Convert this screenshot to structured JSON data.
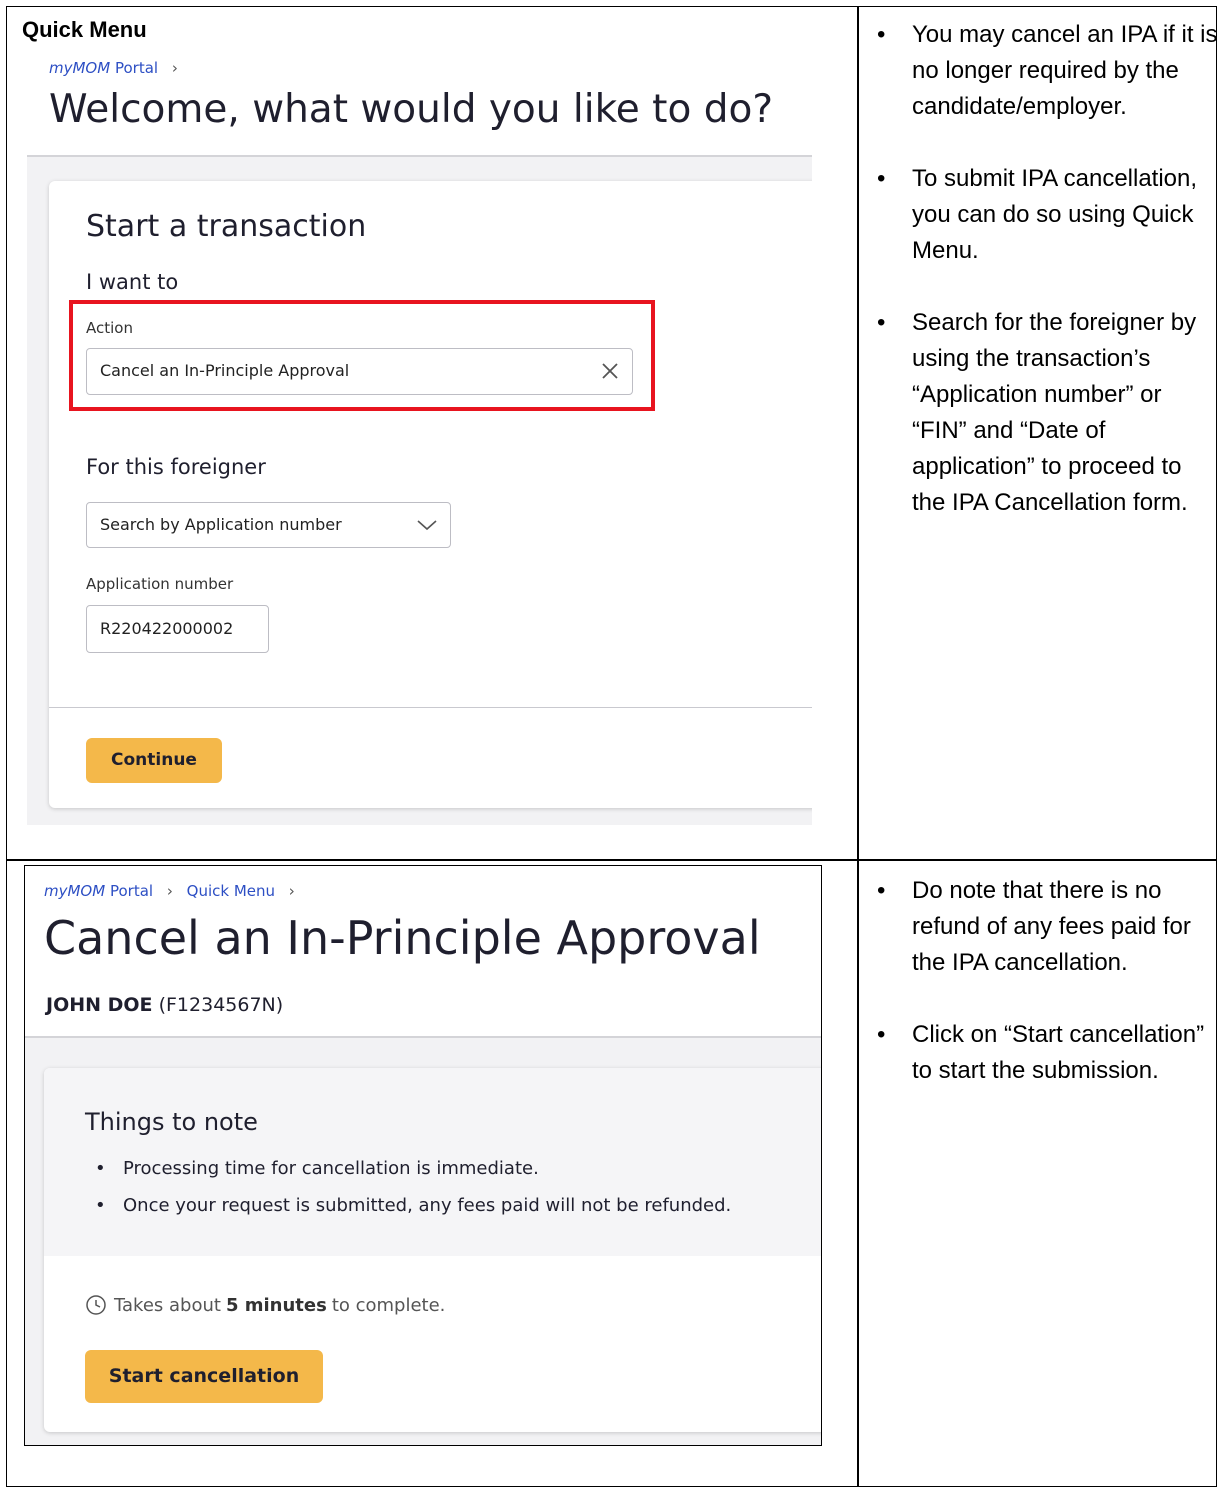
{
  "section": {
    "heading": "Quick Menu"
  },
  "shot1": {
    "breadcrumb": {
      "brand": "myMOM",
      "portal": "Portal"
    },
    "welcome": "Welcome, what would you like to do?",
    "card": {
      "title": "Start a transaction",
      "i_want_to": "I want to",
      "action_label": "Action",
      "action_value": "Cancel an In-Principle Approval",
      "foreigner_heading": "For this foreigner",
      "search_select": "Search by Application number",
      "appno_label": "Application number",
      "appno_value": "R220422000002",
      "continue": "Continue"
    }
  },
  "notes_top": [
    "You may cancel an IPA if it is no longer required by the candidate/employer.",
    "To submit IPA cancellation, you can do so using Quick Menu.",
    "Search for the foreigner by using the transaction’s “Application number” or “FIN” and “Date of application” to proceed to the IPA Cancellation form."
  ],
  "shot2": {
    "breadcrumb": {
      "brand": "myMOM",
      "portal": "Portal",
      "quick_menu": "Quick Menu"
    },
    "title": "Cancel an In-Principle Approval",
    "person_name": "JOHN DOE",
    "person_fin": "(F1234567N)",
    "things_title": "Things to note",
    "things": [
      "Processing time for cancellation is immediate.",
      "Once your request is submitted, any fees paid will not be refunded."
    ],
    "time_prefix": "Takes about",
    "time_value": "5 minutes",
    "time_suffix": "to complete.",
    "start_button": "Start cancellation"
  },
  "notes_bottom": [
    "Do note that there is no refund of any fees paid for the IPA cancellation.",
    "Click on “Start cancellation” to start the submission."
  ],
  "colors": {
    "accent_button": "#f4b84a",
    "highlight_border": "#e8141f",
    "link": "#2d4fc4"
  }
}
